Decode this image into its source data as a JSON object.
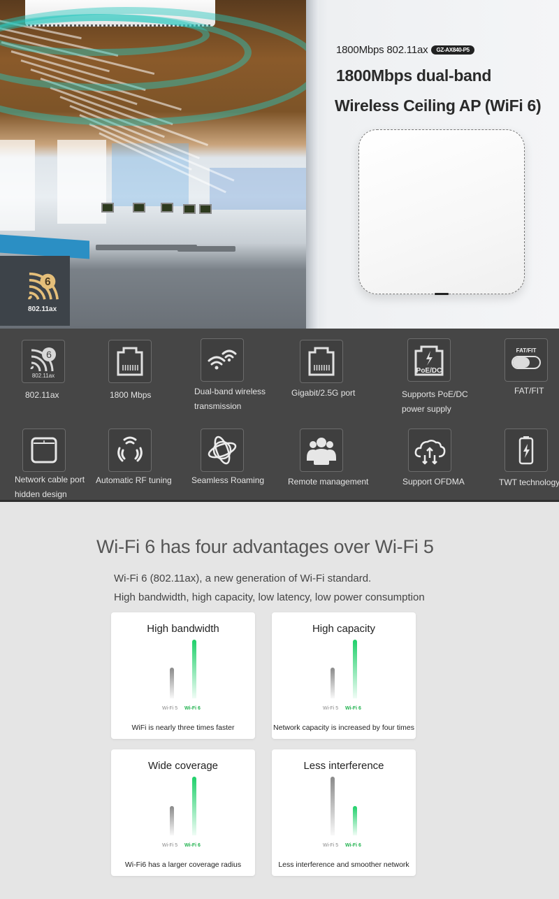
{
  "hero": {
    "spec_line": "1800Mbps 802.11ax",
    "model_badge": "GZ-AX840-P5",
    "title_line1": "1800Mbps dual-band",
    "title_line2": "Wireless Ceiling AP (WiFi 6)",
    "wifi6_logo_label": "802.11ax",
    "wifi6_logo_number": "6"
  },
  "features": [
    {
      "label": "802.11ax",
      "icon": "wifi6-icon",
      "icon_text": "802.11ax"
    },
    {
      "label": "1800 Mbps",
      "icon": "ethernet-port-icon"
    },
    {
      "label": [
        "Dual-band wireless",
        "transmission"
      ],
      "icon": "dual-wifi-icon"
    },
    {
      "label": "Gigabit/2.5G port",
      "icon": "ethernet-port-icon"
    },
    {
      "label": [
        "Supports PoE/DC",
        "power supply"
      ],
      "icon": "poe-dc-icon",
      "icon_text": "PoE/DC"
    },
    {
      "label": "FAT/FIT",
      "icon": "fat-fit-toggle-icon",
      "icon_text": "FAT/FIT"
    },
    {
      "label": [
        "Network cable port",
        "hidden design"
      ],
      "icon": "hidden-port-icon"
    },
    {
      "label": "Automatic RF tuning",
      "icon": "rf-signal-icon"
    },
    {
      "label": "Seamless Roaming",
      "icon": "roaming-orbit-icon"
    },
    {
      "label": "Remote management",
      "icon": "users-group-icon"
    },
    {
      "label": "Support OFDMA",
      "icon": "cloud-transfer-icon"
    },
    {
      "label": "TWT technology",
      "icon": "battery-charge-icon"
    }
  ],
  "advantages": {
    "title": "Wi-Fi 6 has four advantages over Wi-Fi 5",
    "subtitle1": "Wi-Fi 6 (802.11ax), a new generation of Wi-Fi standard.",
    "subtitle2": "High bandwidth, high capacity, low latency, low power consumption",
    "bar_labels": {
      "wifi5": "Wi-Fi 5",
      "wifi6": "Wi-Fi 6"
    },
    "colors": {
      "wifi5": "#8a8a8a",
      "wifi6": "#1fd06a"
    },
    "cards": [
      {
        "title": "High bandwidth",
        "description": "WiFi is nearly three times faster",
        "wifi5_level": 0.52,
        "wifi6_level": 1.0
      },
      {
        "title": "High capacity",
        "description": "Network capacity is increased by four times",
        "wifi5_level": 0.52,
        "wifi6_level": 1.0
      },
      {
        "title": "Wide coverage",
        "description": "Wi-Fi6 has a larger coverage radius",
        "wifi5_level": 0.5,
        "wifi6_level": 1.0
      },
      {
        "title": "Less interference",
        "description": "Less interference and smoother network",
        "wifi5_level": 1.0,
        "wifi6_level": 0.5
      }
    ]
  }
}
